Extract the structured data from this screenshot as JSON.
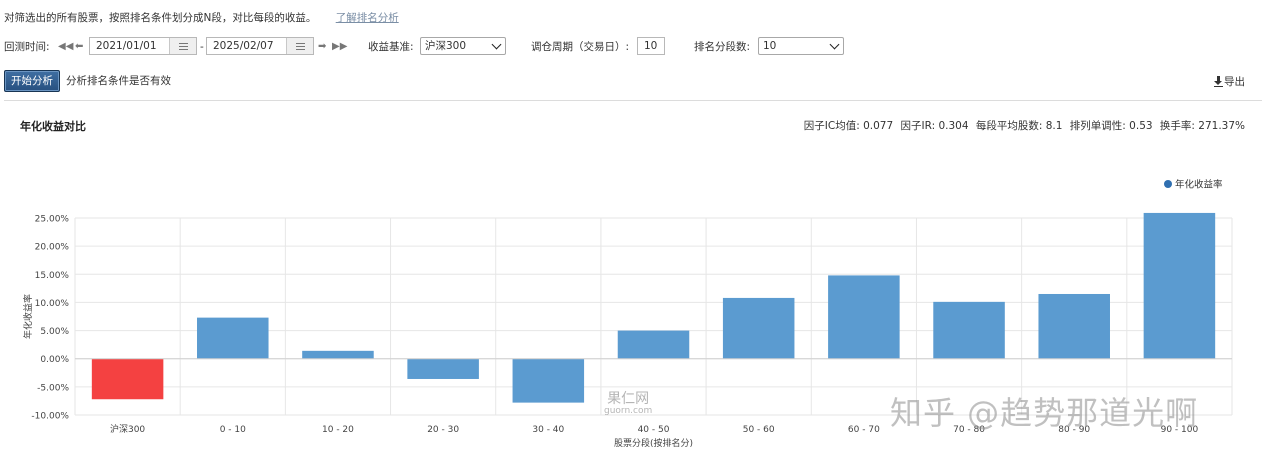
{
  "intro": {
    "text": "对筛选出的所有股票，按照排名条件划分成N段，对比每段的收益。",
    "help_link": "了解排名分析"
  },
  "controls": {
    "backtest_label": "回测时间:",
    "start_date": "2021/01/01",
    "date_separator": "-",
    "end_date": "2025/02/07",
    "benchmark_label": "收益基准:",
    "benchmark_value": "沪深300",
    "period_label": "调仓周期（交易日）:",
    "period_value": "10",
    "segments_label": "排名分段数:",
    "segments_value": "10"
  },
  "actions": {
    "start_label": "开始分析",
    "start_desc": "分析排名条件是否有效",
    "export_label": "导出"
  },
  "chart_header": {
    "title": "年化收益对比",
    "stats": [
      "因子IC均值: 0.077",
      "因子IR: 0.304",
      "每段平均股数: 8.1",
      "排列单调性: 0.53",
      "换手率: 271.37%"
    ]
  },
  "colors": {
    "bar": "#5b9bd0",
    "benchmark_bar": "#f44141",
    "legend_dot": "#2f6fb0",
    "grid": "#e6e6e6"
  },
  "watermark": {
    "main": "知乎 @趋势那道光啊",
    "site": "果仁网",
    "site_url": "guorn.com"
  },
  "chart_data": {
    "type": "bar",
    "title": "",
    "xlabel": "股票分段(按排名分)",
    "ylabel": "年化收益率",
    "ylim": [
      -10,
      25
    ],
    "y_ticks": [
      -10,
      -5,
      0,
      5,
      10,
      15,
      20,
      25
    ],
    "y_tick_labels": [
      "-10.00%",
      "-5.00%",
      "0.00%",
      "5.00%",
      "10.00%",
      "15.00%",
      "20.00%",
      "25.00%"
    ],
    "categories": [
      "沪深300",
      "0 - 10",
      "10 - 20",
      "20 - 30",
      "30 - 40",
      "40 - 50",
      "50 - 60",
      "60 - 70",
      "70 - 80",
      "80 - 90",
      "90 - 100"
    ],
    "series": [
      {
        "name": "年化收益率",
        "values": [
          -7.2,
          7.3,
          1.4,
          -3.6,
          -7.8,
          5.0,
          10.8,
          14.8,
          10.1,
          11.5,
          25.9
        ]
      }
    ],
    "highlight_index": 0,
    "grid": true,
    "legend": "top-right"
  }
}
